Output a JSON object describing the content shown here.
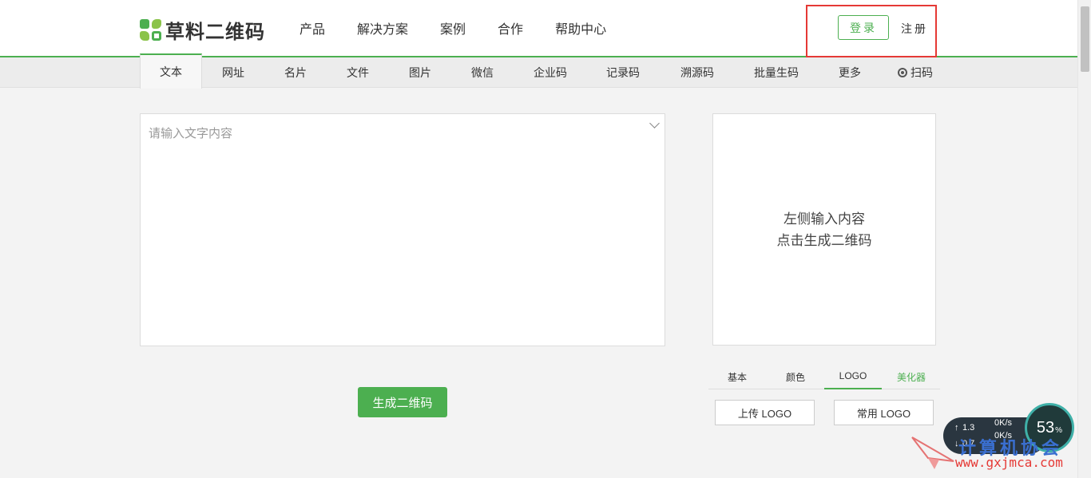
{
  "brand": {
    "name": "草料二维码"
  },
  "topnav": [
    "产品",
    "解决方案",
    "案例",
    "合作",
    "帮助中心"
  ],
  "auth": {
    "login": "登录",
    "register": "注册"
  },
  "tabs": [
    "文本",
    "网址",
    "名片",
    "文件",
    "图片",
    "微信",
    "企业码",
    "记录码",
    "溯源码",
    "批量生码",
    "更多",
    "扫码"
  ],
  "active_tab": "文本",
  "input": {
    "placeholder": "请输入文字内容",
    "value": ""
  },
  "generate_button": "生成二维码",
  "preview": {
    "line1": "左侧输入内容",
    "line2": "点击生成二维码"
  },
  "option_tabs": [
    "基本",
    "颜色",
    "LOGO",
    "美化器"
  ],
  "active_option_tab": "LOGO",
  "logo_buttons": {
    "upload": "上传 LOGO",
    "common": "常用 LOGO"
  },
  "net_monitor": {
    "upload_speed": "1.3",
    "download_speed": "0.7",
    "up_rate": "0K/s",
    "down_rate": "0K/s",
    "usage": "53",
    "usage_unit": "%"
  },
  "watermark": {
    "name": "计算机协会",
    "url": "www.gxjmca.com"
  },
  "colors": {
    "accent": "#4caf50",
    "highlight_box": "#e53935"
  }
}
